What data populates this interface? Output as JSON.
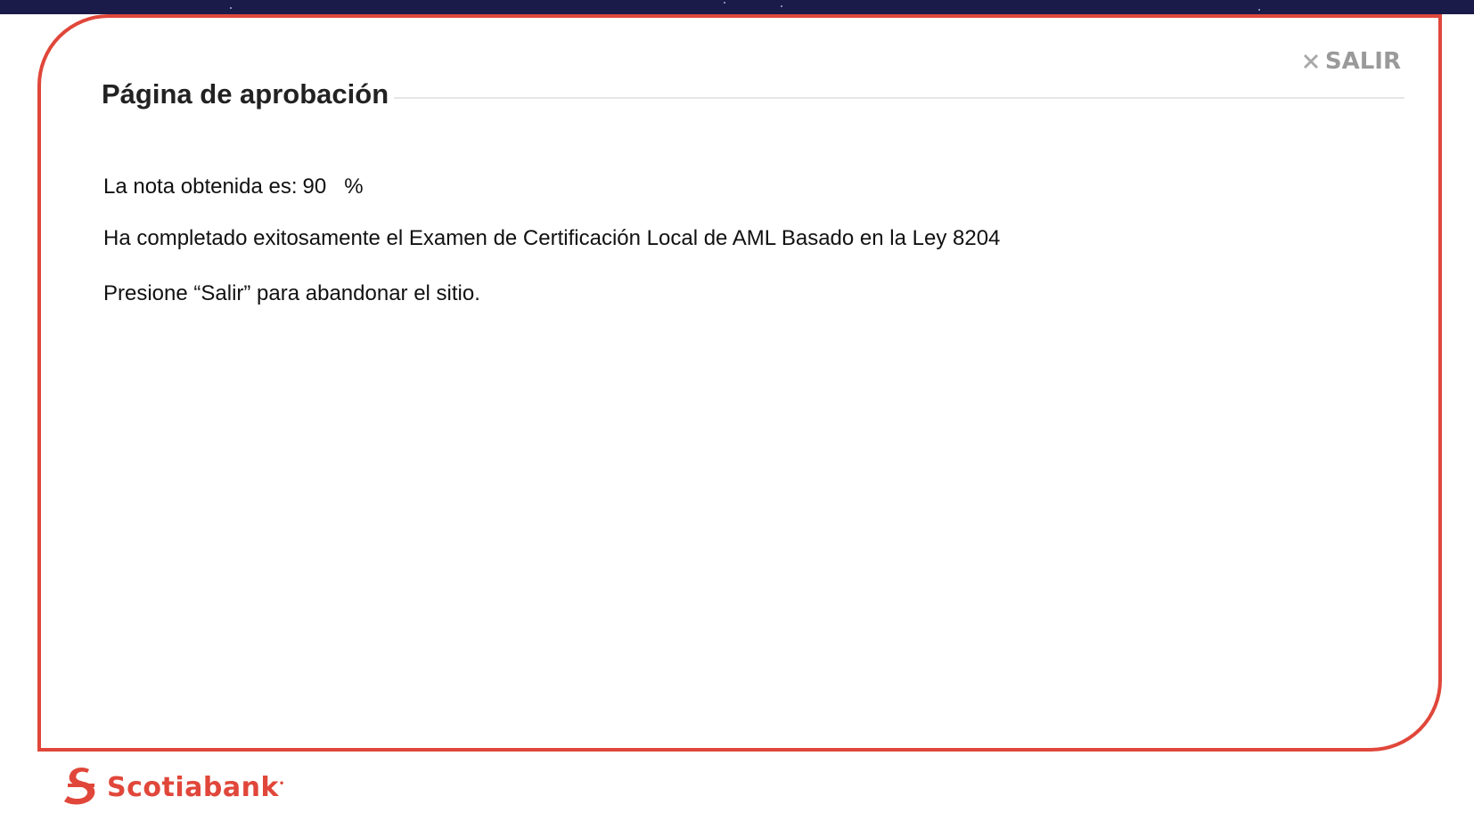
{
  "header": {
    "exit_label": "SALIR",
    "exit_icon": "close-icon"
  },
  "page": {
    "title": "Página de aprobación"
  },
  "result": {
    "score_label": "La nota obtenida es:",
    "score_value": "90",
    "score_unit": "%",
    "message": "Ha completado exitosamente el Examen de Certificación Local de AML Basado en la Ley 8204",
    "instruction": "Presione “Salir” para abandonar el sitio."
  },
  "footer": {
    "brand": "Scotiabank",
    "brand_icon": "scotiabank-logo-icon"
  },
  "colors": {
    "accent": "#e0473a",
    "header_band": "#1b1b4a",
    "exit_text": "#9a9a9a"
  }
}
